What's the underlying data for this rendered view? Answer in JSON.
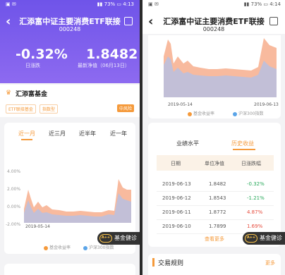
{
  "left": {
    "status": {
      "time": "4:13",
      "battery": "73%"
    },
    "title": "汇添富中证主要消费ETF联接",
    "code": "000248",
    "change": {
      "value": "-0.32%",
      "label": "日涨跌"
    },
    "nav": {
      "value": "1.8482",
      "label": "最新净值（06月13日）"
    },
    "manager": {
      "name": "汇添富基金",
      "tags": [
        "ETF联接基金",
        "指数型"
      ],
      "risk": "中风险"
    },
    "tabs": [
      "近一月",
      "近三月",
      "近半年",
      "近一年"
    ],
    "y_ticks": [
      "4.00%",
      "2.00%",
      "0.00%",
      "-2.00%"
    ],
    "x_start": "2019-05-14",
    "legend": [
      "基金收益率",
      "沪深300指数"
    ],
    "badge": "基金健诊",
    "badge_icon": "A++"
  },
  "right": {
    "status": {
      "time": "4:14",
      "battery": "73%"
    },
    "title": "汇添富中证主要消费ETF联接",
    "code": "000248",
    "x_start": "2019-05-14",
    "x_end": "2019-06-13",
    "legend": [
      "基金收益率",
      "沪深300指数"
    ],
    "tabs": [
      "业绩水平",
      "历史收益"
    ],
    "table": {
      "headers": [
        "日期",
        "单位净值",
        "日涨跌幅"
      ],
      "rows": [
        {
          "date": "2019-06-13",
          "nav": "1.8482",
          "chg": "-0.32%"
        },
        {
          "date": "2019-06-12",
          "nav": "1.8543",
          "chg": "-1.21%"
        },
        {
          "date": "2019-06-11",
          "nav": "1.8772",
          "chg": "4.87%"
        },
        {
          "date": "2019-06-10",
          "nav": "1.7899",
          "chg": "1.69%"
        }
      ]
    },
    "more": "查看更多",
    "badge": "基金健诊",
    "badge_icon": "A++",
    "rules": {
      "label": "交易规则",
      "more": "更多"
    }
  },
  "colors": {
    "accent": "#f59a3b",
    "purple": "#7b5ced",
    "fund": "#f6a37d",
    "index": "#5aa4e8",
    "up": "#e64a3b",
    "down": "#27a85a"
  }
}
